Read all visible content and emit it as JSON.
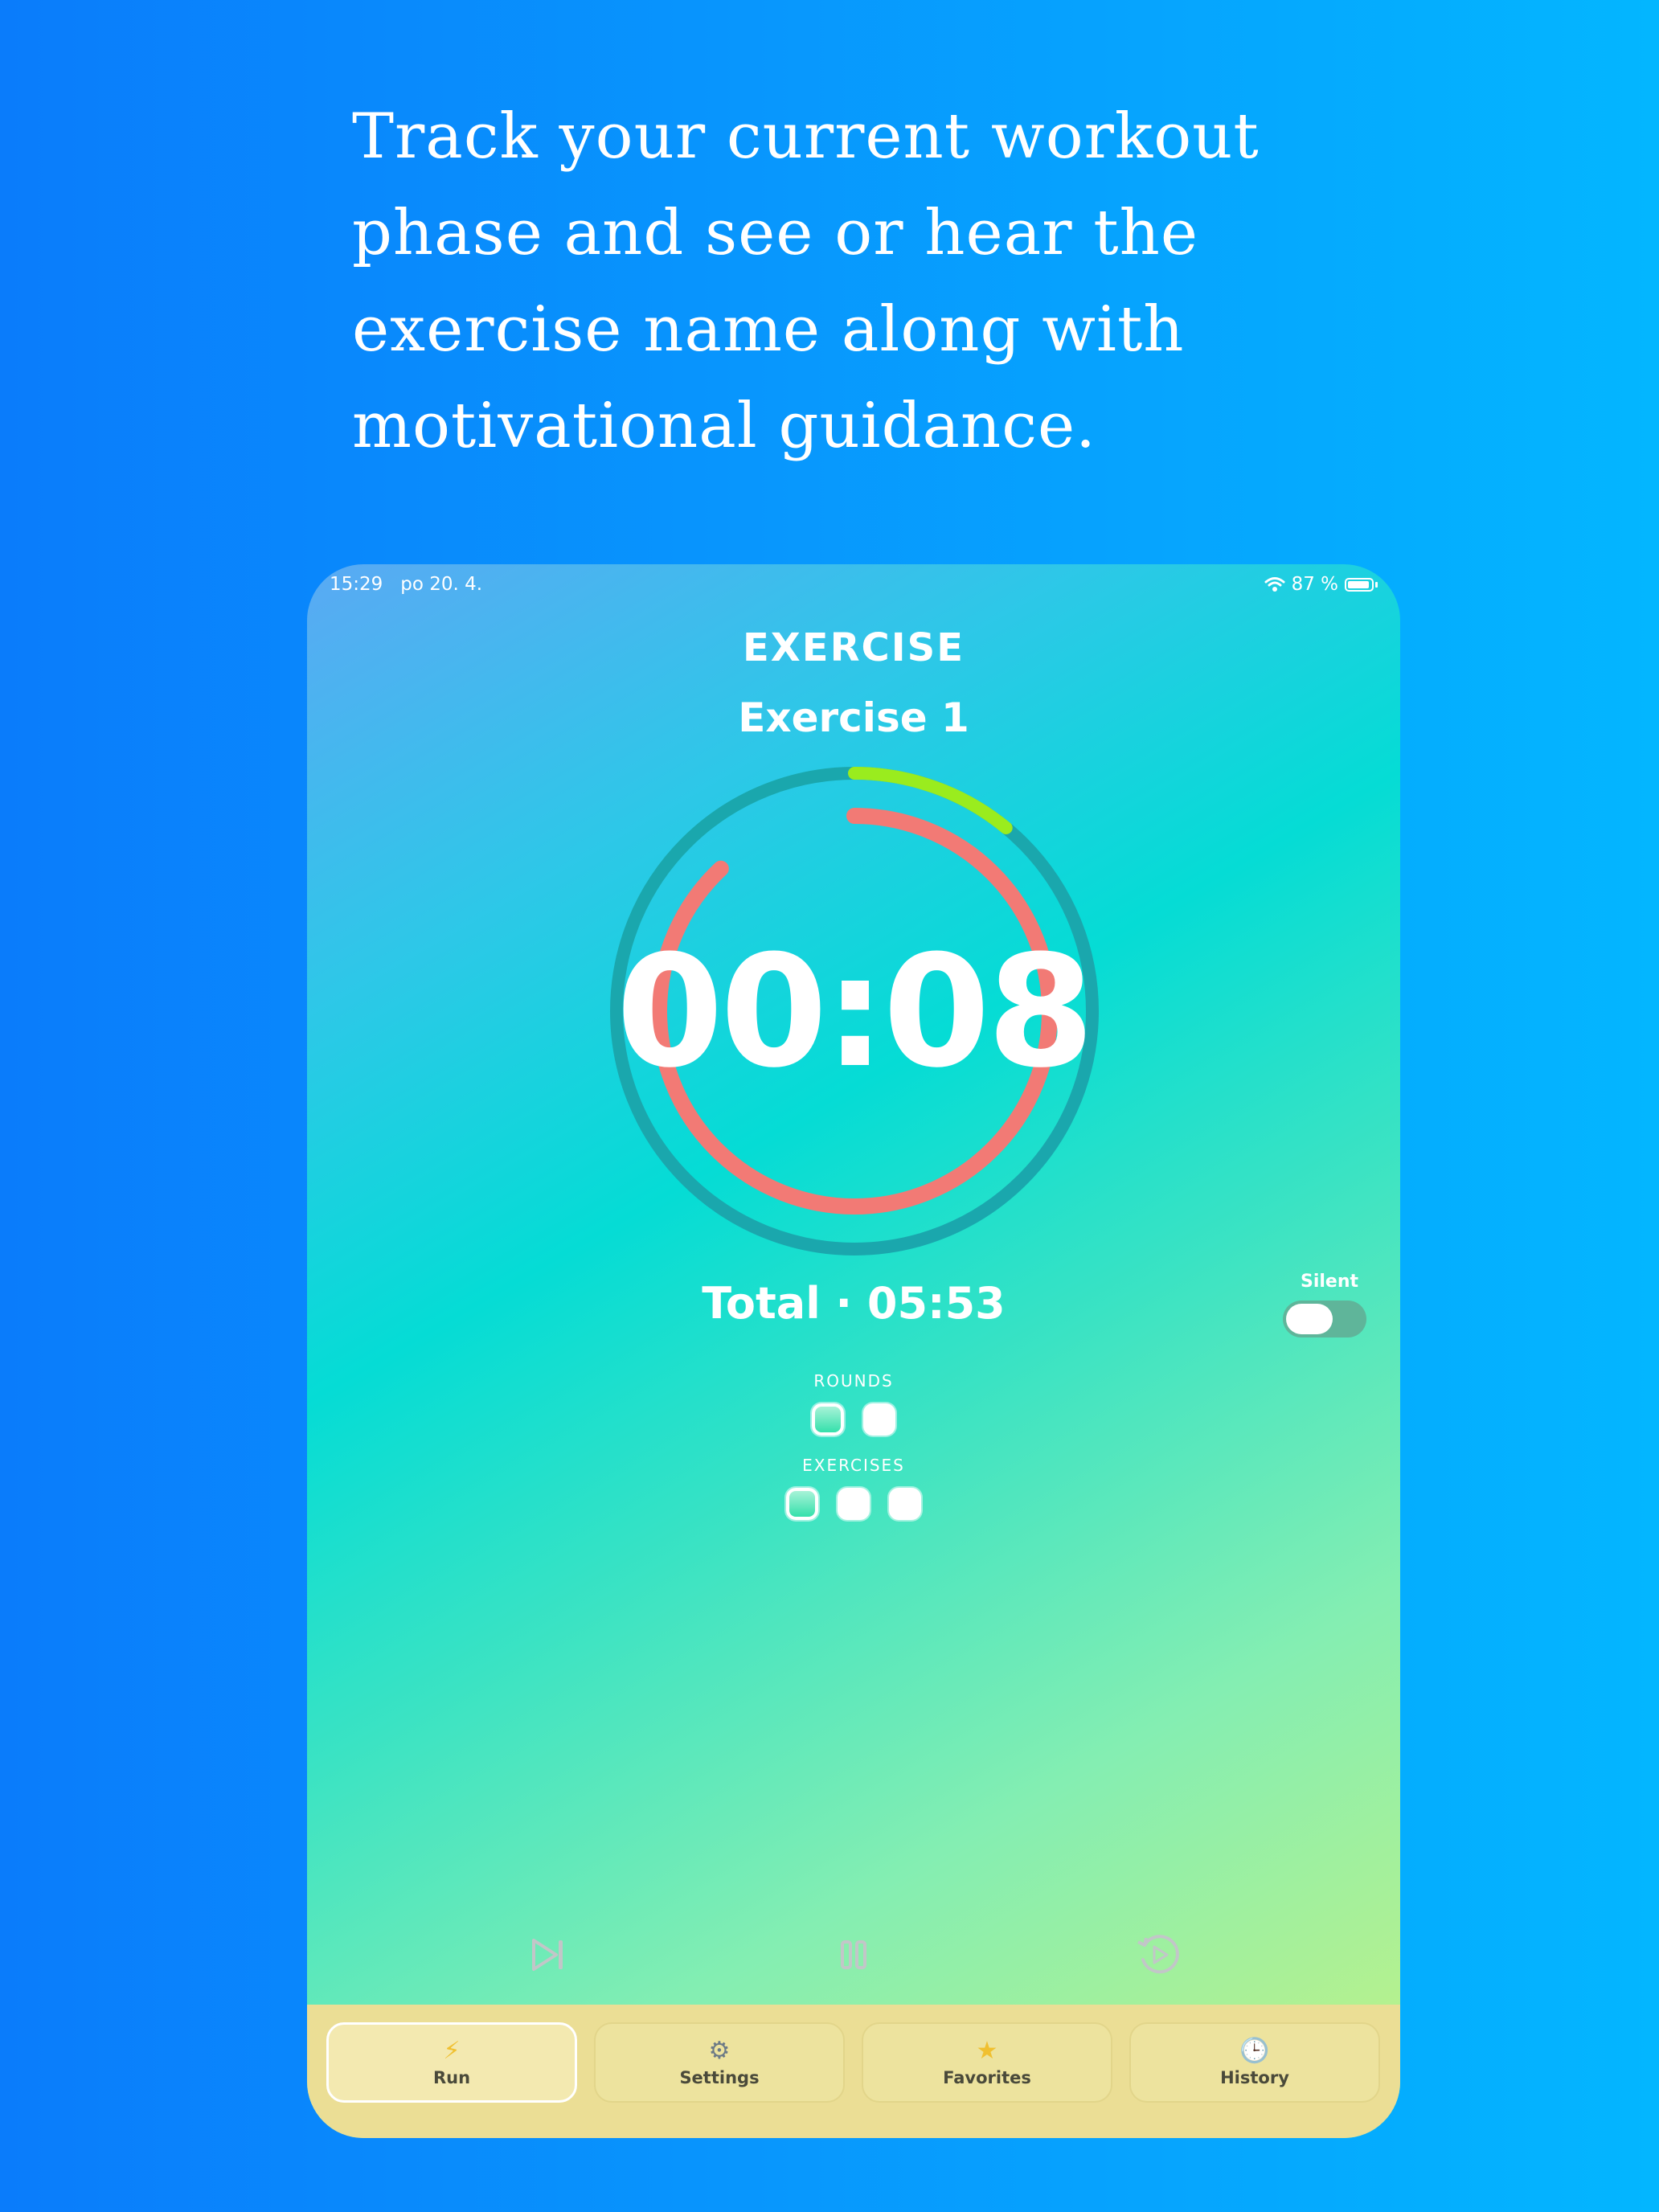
{
  "headline": "Track your current workout phase and see or hear the exercise name along with motivational guidance.",
  "status_bar": {
    "time": "15:29",
    "date": "po 20. 4.",
    "battery": "87 %",
    "battery_level": 0.87
  },
  "phase_title": "EXERCISE",
  "exercise_name": "Exercise 1",
  "timer": "00:08",
  "ring": {
    "outer_progress": 0.11,
    "inner_progress": 0.88,
    "outer_color": "#9aec1e",
    "inner_color": "#f27a75",
    "track_color": "#1aa7ad"
  },
  "total": "Total · 05:53",
  "silent": {
    "label": "Silent",
    "on": false
  },
  "rounds": {
    "label": "ROUNDS",
    "count": 2,
    "current": 1
  },
  "exercises": {
    "label": "EXERCISES",
    "count": 3,
    "current": 1
  },
  "tabs": [
    {
      "label": "Run",
      "icon": "lightning-icon",
      "selected": true
    },
    {
      "label": "Settings",
      "icon": "gear-icon",
      "selected": false
    },
    {
      "label": "Favorites",
      "icon": "star-icon",
      "selected": false
    },
    {
      "label": "History",
      "icon": "clock-icon",
      "selected": false
    }
  ],
  "colors": {
    "background_blue": "#0a7cfb",
    "tabbar": "#ebde95",
    "accent_green": "#34e0ab"
  }
}
